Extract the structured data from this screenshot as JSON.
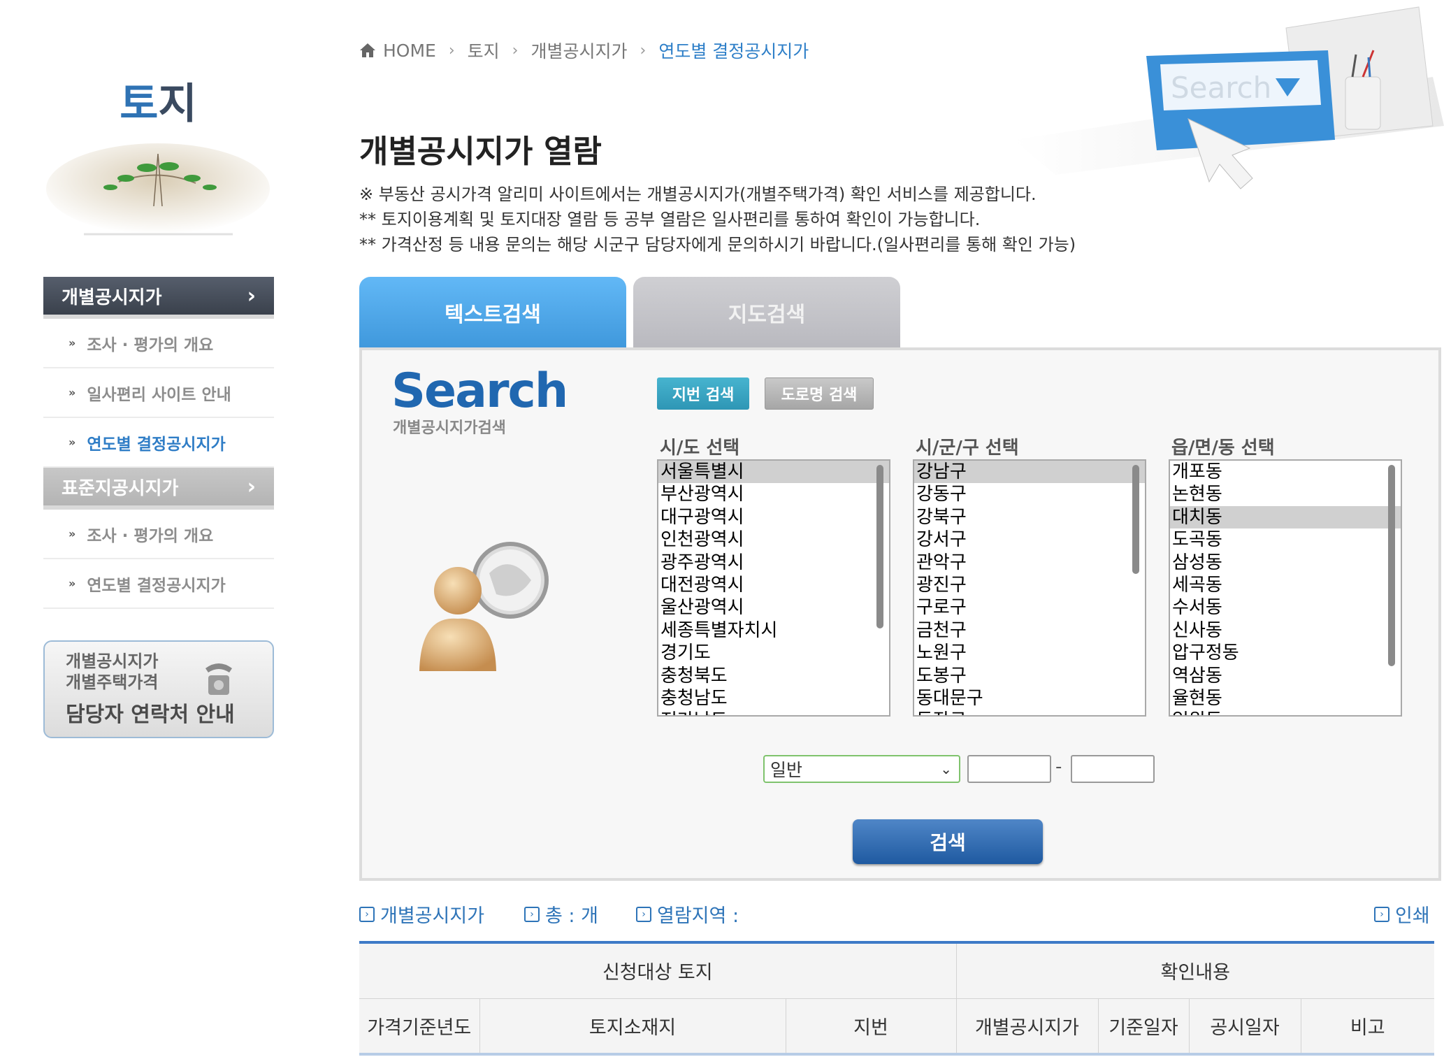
{
  "sidebar": {
    "title": "토지",
    "menu_head_1": "개별공시지가",
    "menu_head_1_items": [
      "조사 · 평가의 개요",
      "일사편리 사이트 안내",
      "연도별 결정공시지가"
    ],
    "menu_head_2": "표준지공시지가",
    "menu_head_2_items": [
      "조사 · 평가의 개요",
      "연도별 결정공시지가"
    ],
    "contact_line1": "개별공시지가",
    "contact_line2": "개별주택가격",
    "contact_line3": "담당자 연락처 안내"
  },
  "breadcrumb": {
    "home": "HOME",
    "items": [
      "토지",
      "개별공시지가"
    ],
    "current": "연도별 결정공시지가"
  },
  "page_title": "개별공시지가 열람",
  "notices": [
    "※ 부동산 공시가격 알리미 사이트에서는 개별공시지가(개별주택가격) 확인 서비스를 제공합니다.",
    "** 토지이용계획 및 토지대장 열람 등 공부 열람은 일사편리를 통하여 확인이 가능합니다.",
    "** 가격산정 등 내용 문의는 해당 시군구 담당자에게 문의하시기 바랍니다.(일사편리를 통해 확인 가능)"
  ],
  "header_illustration_text": "Search",
  "tabs": [
    "텍스트검색",
    "지도검색"
  ],
  "search": {
    "logo": "Search",
    "logo_sub": "개별공시지가검색",
    "type_buttons": [
      "지번 검색",
      "도로명 검색"
    ],
    "labels": [
      "시/도 선택",
      "시/군/구 선택",
      "읍/면/동 선택"
    ],
    "sido": [
      "서울특별시",
      "부산광역시",
      "대구광역시",
      "인천광역시",
      "광주광역시",
      "대전광역시",
      "울산광역시",
      "세종특별자치시",
      "경기도",
      "충청북도",
      "충청남도",
      "전라남도"
    ],
    "sido_selected": 0,
    "sigungu": [
      "강남구",
      "강동구",
      "강북구",
      "강서구",
      "관악구",
      "광진구",
      "구로구",
      "금천구",
      "노원구",
      "도봉구",
      "동대문구",
      "동작구"
    ],
    "sigungu_selected": 0,
    "dong": [
      "개포동",
      "논현동",
      "대치동",
      "도곡동",
      "삼성동",
      "세곡동",
      "수서동",
      "신사동",
      "압구정동",
      "역삼동",
      "율현동",
      "일원동"
    ],
    "dong_selected": 2,
    "land_type": "일반",
    "bonbun": "",
    "bubun": "",
    "dash": "-",
    "submit": "검색"
  },
  "result_info": {
    "list": "개별공시지가",
    "total": "총 : 개",
    "region": "열람지역 :",
    "print": "인쇄"
  },
  "table": {
    "group_headers": [
      "신청대상 토지",
      "확인내용"
    ],
    "columns": [
      "가격기준년도",
      "토지소재지",
      "지번",
      "개별공시지가",
      "기준일자",
      "공시일자",
      "비고"
    ]
  },
  "colors": {
    "accent_blue": "#2e7fc8",
    "tab_active": "#4ea7e9",
    "tab_inactive": "#c4c4c9",
    "search_button": "#2a63a8"
  }
}
